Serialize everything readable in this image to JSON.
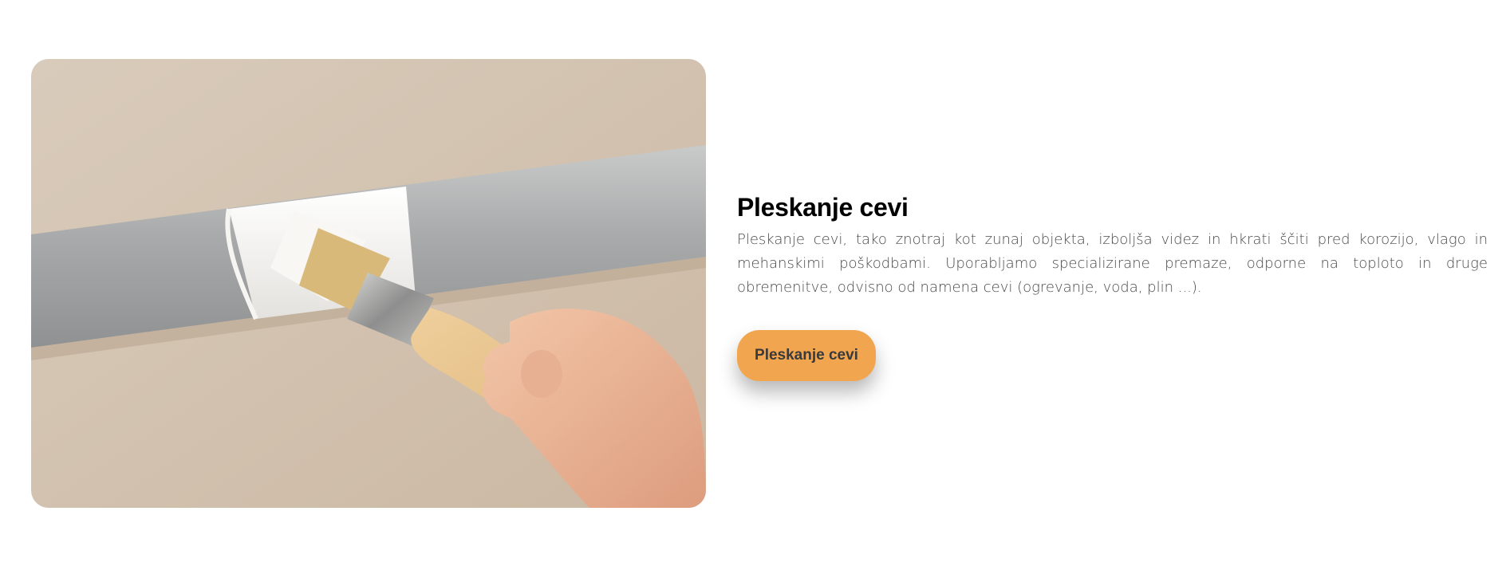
{
  "service": {
    "title": "Pleskanje cevi",
    "description": "Pleskanje cevi, tako znotraj kot zunaj objekta, izboljša videz in hkrati ščiti pred korozijo, vlago in mehanskimi poškodbami. Uporabljamo specializirane premaze, odporne na toploto in druge obremenitve, odvisno od namena cevi (ogrevanje, voda, plin ...).",
    "button_label": "Pleskanje cevi"
  },
  "colors": {
    "accent": "#f2a54f",
    "title": "#000000",
    "text": "#4a4a4a",
    "background": "#ffffff"
  }
}
